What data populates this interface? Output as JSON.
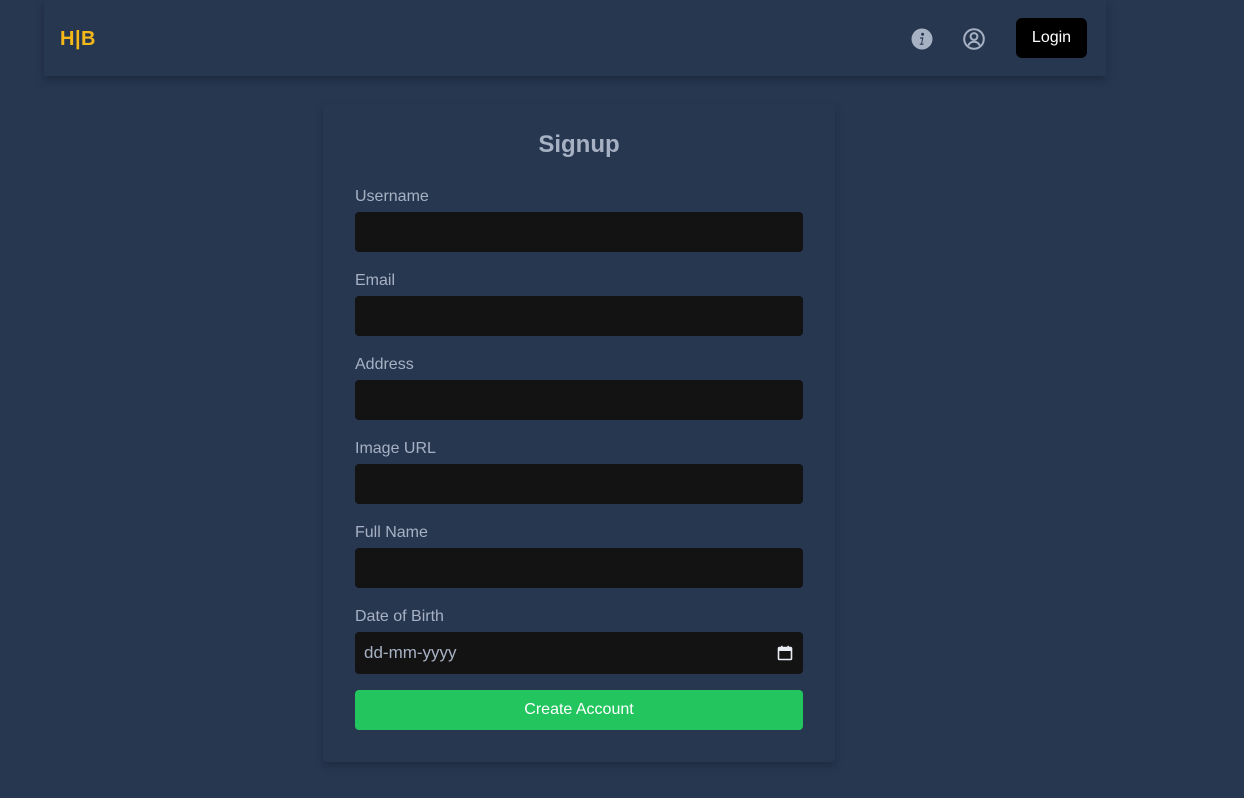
{
  "navbar": {
    "logo": "H|B",
    "login_label": "Login",
    "icons": [
      "info-icon",
      "user-circle-icon"
    ]
  },
  "signup": {
    "title": "Signup",
    "fields": [
      {
        "label": "Username",
        "value": ""
      },
      {
        "label": "Email",
        "value": ""
      },
      {
        "label": "Address",
        "value": ""
      },
      {
        "label": "Image URL",
        "value": ""
      },
      {
        "label": "Full Name",
        "value": ""
      },
      {
        "label": "Date of Birth",
        "placeholder": "dd-mm-yyyy",
        "icon": "calendar-icon"
      }
    ],
    "submit_label": "Create Account"
  },
  "colors": {
    "background": "#283750",
    "logo": "#f5b819",
    "input_background": "#131314",
    "label": "#a7b1c4",
    "login_button": "#000000",
    "submit_button": "#22c55e"
  }
}
